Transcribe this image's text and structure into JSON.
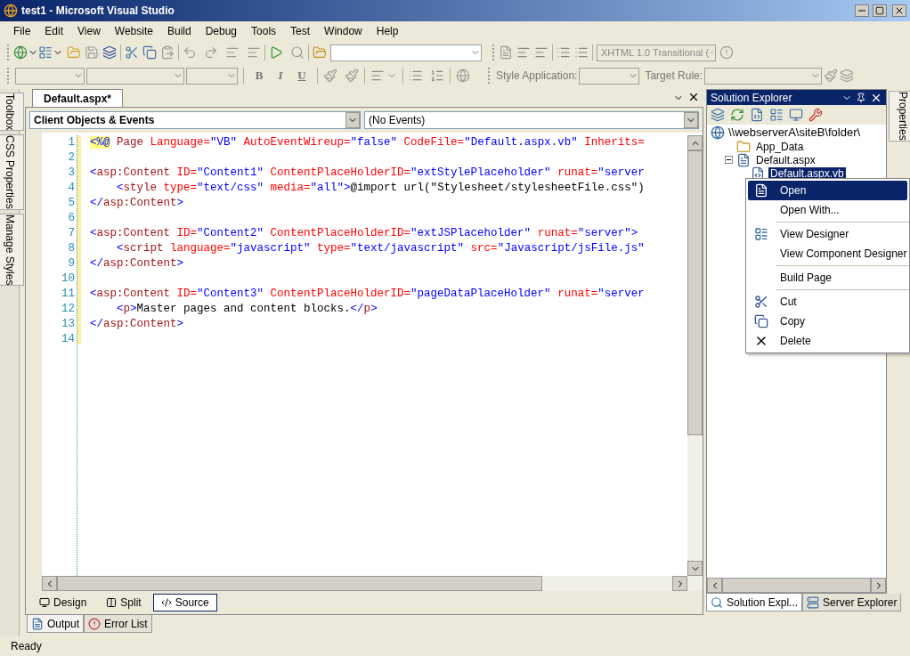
{
  "window": {
    "title": "test1 - Microsoft Visual Studio"
  },
  "menu": [
    "File",
    "Edit",
    "View",
    "Website",
    "Build",
    "Debug",
    "Tools",
    "Test",
    "Window",
    "Help"
  ],
  "toolbar": {
    "doctype": "XHTML 1.0 Transitional (",
    "format_buttons": [
      "B",
      "I",
      "U"
    ],
    "style_application_label": "Style Application:",
    "target_rule_label": "Target Rule:"
  },
  "side_tabs": [
    "Toolbox",
    "CSS Properties",
    "Manage Styles"
  ],
  "editor": {
    "tab": "Default.aspx*",
    "object_dropdown": "Client Objects & Events",
    "event_dropdown": "(No Events)",
    "lines": [
      {
        "number": "1",
        "indented": false,
        "tokens": [
          {
            "kind": "directive",
            "text": "<%@"
          },
          {
            "kind": "tag",
            "text": " Page "
          },
          {
            "kind": "attr",
            "text": "Language="
          },
          {
            "kind": "value",
            "text": "\"VB\""
          },
          {
            "kind": "attr",
            "text": " AutoEventWireup="
          },
          {
            "kind": "value",
            "text": "\"false\""
          },
          {
            "kind": "attr",
            "text": " CodeFile="
          },
          {
            "kind": "value",
            "text": "\"Default.aspx.vb\""
          },
          {
            "kind": "attr",
            "text": " Inherits="
          }
        ]
      },
      {
        "number": "2"
      },
      {
        "number": "3",
        "indented": false,
        "tokens": [
          {
            "kind": "delim",
            "text": "<"
          },
          {
            "kind": "tag",
            "text": "asp:Content"
          },
          {
            "kind": "attr",
            "text": " ID="
          },
          {
            "kind": "value",
            "text": "\"Content1\""
          },
          {
            "kind": "attr",
            "text": " ContentPlaceHolderID="
          },
          {
            "kind": "value",
            "text": "\"extStylePlaceholder\""
          },
          {
            "kind": "attr",
            "text": " runat="
          },
          {
            "kind": "value",
            "text": "\"server"
          }
        ]
      },
      {
        "number": "4",
        "indented": true,
        "tokens": [
          {
            "kind": "delim",
            "text": "<"
          },
          {
            "kind": "tag",
            "text": "style"
          },
          {
            "kind": "attr",
            "text": " type="
          },
          {
            "kind": "value",
            "text": "\"text/css\""
          },
          {
            "kind": "attr",
            "text": " media="
          },
          {
            "kind": "value",
            "text": "\"all\""
          },
          {
            "kind": "delim",
            "text": ">"
          },
          {
            "kind": "text",
            "text": "@import url(\"Stylesheet/stylesheetFile.css\")"
          }
        ]
      },
      {
        "number": "5",
        "indented": false,
        "tokens": [
          {
            "kind": "delim",
            "text": "</"
          },
          {
            "kind": "tag",
            "text": "asp:Content"
          },
          {
            "kind": "delim",
            "text": ">"
          }
        ]
      },
      {
        "number": "6"
      },
      {
        "number": "7",
        "indented": false,
        "tokens": [
          {
            "kind": "delim",
            "text": "<"
          },
          {
            "kind": "tag",
            "text": "asp:Content"
          },
          {
            "kind": "attr",
            "text": " ID="
          },
          {
            "kind": "value",
            "text": "\"Content2\""
          },
          {
            "kind": "attr",
            "text": " ContentPlaceHolderID="
          },
          {
            "kind": "value",
            "text": "\"extJSPlaceholder\""
          },
          {
            "kind": "attr",
            "text": " runat="
          },
          {
            "kind": "value",
            "text": "\"server\""
          },
          {
            "kind": "delim",
            "text": ">"
          }
        ]
      },
      {
        "number": "8",
        "indented": true,
        "tokens": [
          {
            "kind": "delim",
            "text": "<"
          },
          {
            "kind": "tag",
            "text": "script"
          },
          {
            "kind": "attr",
            "text": " language="
          },
          {
            "kind": "value",
            "text": "\"javascript\""
          },
          {
            "kind": "attr",
            "text": " type="
          },
          {
            "kind": "value",
            "text": "\"text/javascript\""
          },
          {
            "kind": "attr",
            "text": " src="
          },
          {
            "kind": "value",
            "text": "\"Javascript/jsFile.js\""
          }
        ]
      },
      {
        "number": "9",
        "indented": false,
        "tokens": [
          {
            "kind": "delim",
            "text": "</"
          },
          {
            "kind": "tag",
            "text": "asp:Content"
          },
          {
            "kind": "delim",
            "text": ">"
          }
        ]
      },
      {
        "number": "10"
      },
      {
        "number": "11",
        "indented": false,
        "tokens": [
          {
            "kind": "delim",
            "text": "<"
          },
          {
            "kind": "tag",
            "text": "asp:Content"
          },
          {
            "kind": "attr",
            "text": " ID="
          },
          {
            "kind": "value",
            "text": "\"Content3\""
          },
          {
            "kind": "attr",
            "text": " ContentPlaceHolderID="
          },
          {
            "kind": "value",
            "text": "\"pageDataPlaceHolder\""
          },
          {
            "kind": "attr",
            "text": " runat="
          },
          {
            "kind": "value",
            "text": "\"server"
          }
        ]
      },
      {
        "number": "12",
        "indented": true,
        "tokens": [
          {
            "kind": "delim",
            "text": "<"
          },
          {
            "kind": "tag",
            "text": "p"
          },
          {
            "kind": "delim",
            "text": ">"
          },
          {
            "kind": "text",
            "text": "Master pages and content blocks."
          },
          {
            "kind": "delim",
            "text": "</"
          },
          {
            "kind": "tag",
            "text": "p"
          },
          {
            "kind": "delim",
            "text": ">"
          }
        ]
      },
      {
        "number": "13",
        "indented": false,
        "tokens": [
          {
            "kind": "delim",
            "text": "</"
          },
          {
            "kind": "tag",
            "text": "asp:Content"
          },
          {
            "kind": "delim",
            "text": ">"
          }
        ]
      },
      {
        "number": "14"
      }
    ],
    "view_tabs": [
      {
        "label": "Design",
        "selected": false
      },
      {
        "label": "Split",
        "selected": false
      },
      {
        "label": "Source",
        "selected": true
      }
    ]
  },
  "bottom_tabs": [
    {
      "label": "Output",
      "selected": true
    },
    {
      "label": "Error List",
      "selected": false
    }
  ],
  "solution_explorer": {
    "title": "Solution Explorer",
    "tree": {
      "label": "\\\\webserverA\\siteB\\folder\\",
      "children": [
        {
          "label": "App_Data",
          "kind": "folder",
          "selected": false
        },
        {
          "label": "Default.aspx",
          "kind": "page",
          "expanded": true,
          "selected": false,
          "children": [
            {
              "label": "Default.aspx.vb",
              "selected": true
            }
          ]
        }
      ]
    },
    "tabs": [
      {
        "label": "Solution Expl...",
        "selected": true
      },
      {
        "label": "Server Explorer",
        "selected": false
      }
    ]
  },
  "properties_tab": "Properties",
  "context_menu": [
    {
      "kind": "item",
      "label": "Open",
      "selected": true
    },
    {
      "kind": "item",
      "label": "Open With...",
      "selected": false
    },
    {
      "kind": "separator"
    },
    {
      "kind": "item",
      "label": "View Designer",
      "selected": false
    },
    {
      "kind": "item",
      "label": "View Component Designer",
      "selected": false
    },
    {
      "kind": "separator"
    },
    {
      "kind": "item",
      "label": "Build Page",
      "selected": false
    },
    {
      "kind": "separator"
    },
    {
      "kind": "item",
      "label": "Cut",
      "selected": false
    },
    {
      "kind": "item",
      "label": "Copy",
      "selected": false
    },
    {
      "kind": "item",
      "label": "Delete",
      "selected": false
    }
  ],
  "status_bar": "Ready"
}
